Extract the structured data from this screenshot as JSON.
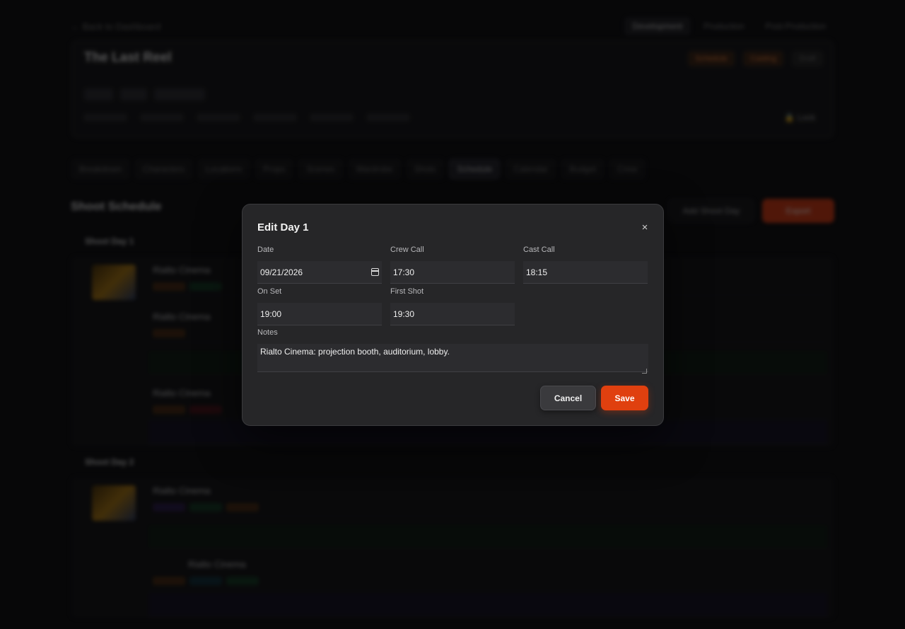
{
  "background": {
    "back_link": "← Back to Dashboard",
    "mode_tabs": [
      "Development",
      "Production",
      "Post-Production"
    ],
    "project": {
      "title": "The Last Reel",
      "logline": "",
      "status_pills": [
        "Schedule",
        "Casting",
        "Draft"
      ],
      "lock_label": "Lock"
    },
    "section_tabs": [
      "Breakdown",
      "Characters",
      "Locations",
      "Props",
      "Scenes",
      "Wardrobe",
      "Shots",
      "Schedule",
      "Calendar",
      "Budget",
      "Crew"
    ],
    "schedule": {
      "title": "Shoot Schedule",
      "actions": [
        "Add Shoot Day",
        "Export"
      ]
    },
    "days": [
      {
        "label": "Shoot Day 1",
        "rows": [
          "Rialto Cinema",
          "Rialto Cinema",
          "Rialto Cinema"
        ]
      },
      {
        "label": "Shoot Day 2",
        "rows": [
          "Rialto Cinema",
          "Rialto Cinema"
        ]
      }
    ]
  },
  "modal": {
    "title": "Edit Day 1",
    "close_glyph": "×",
    "fields": {
      "date": {
        "label": "Date",
        "value": "09/21/2026"
      },
      "crew_call": {
        "label": "Crew Call",
        "value": "17:30"
      },
      "cast_call": {
        "label": "Cast Call",
        "value": "18:15"
      },
      "on_set": {
        "label": "On Set",
        "value": "19:00"
      },
      "first_shot": {
        "label": "First Shot",
        "value": "19:30"
      },
      "notes": {
        "label": "Notes",
        "value": "Rialto Cinema: projection booth, auditorium, lobby."
      }
    },
    "cancel_label": "Cancel",
    "save_label": "Save"
  },
  "colors": {
    "accent": "#e0400f",
    "modal_bg": "#262628",
    "page_bg": "#0b0b0d"
  }
}
